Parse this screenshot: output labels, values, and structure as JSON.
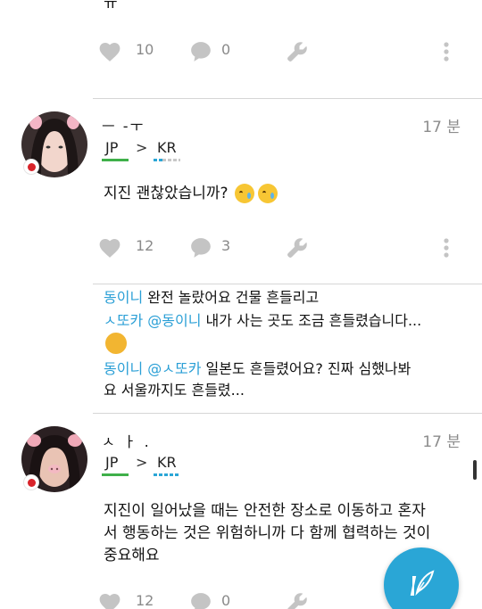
{
  "top_fragment": {
    "text": "ㅠ"
  },
  "posts": [
    {
      "actions": {
        "likes": "10",
        "comments": "0"
      }
    },
    {
      "username": "ㅡ -ㅜ",
      "time": "17 분",
      "lang_src": "JP",
      "lang_arrow": ">",
      "lang_dst": "KR",
      "text": "지진 괜찮았습니까?",
      "actions": {
        "likes": "12",
        "comments": "3"
      },
      "comments": [
        {
          "name": "동이니",
          "text": "완전 놀랐어요 건물 흔들리고"
        },
        {
          "name": "ㅅ또카",
          "mention": "@동이니",
          "text": "내가 사는 곳도 조금 흔들렸습니다..."
        },
        {
          "name": "동이니",
          "mention": "@ㅅ또카",
          "text": "일본도 흔들렸어요? 진짜 심했나봐",
          "text2": "요 서울까지도 흔들렸..."
        }
      ]
    },
    {
      "username": "ㅅ ㅏ .",
      "time": "17 분",
      "lang_src": "JP",
      "lang_arrow": ">",
      "lang_dst": "KR",
      "text_lines": [
        "지진이 일어났을 때는 안전한 장소로 이동하고 혼자",
        "서 행동하는 것은 위험하니까 다 함께 협력하는 것이",
        "중요해요"
      ],
      "actions": {
        "likes": "12",
        "comments": "0"
      }
    }
  ],
  "colors": {
    "accent": "#2aa6d6",
    "flag_red": "#d8232a",
    "lang_green": "#3fb04a",
    "muted": "#8c8c8c"
  },
  "icons": {
    "like": "heart-icon",
    "comment": "speech-bubble-icon",
    "tools": "wrench-icon",
    "more": "more-vertical-icon",
    "fab": "quill-pen-icon"
  }
}
